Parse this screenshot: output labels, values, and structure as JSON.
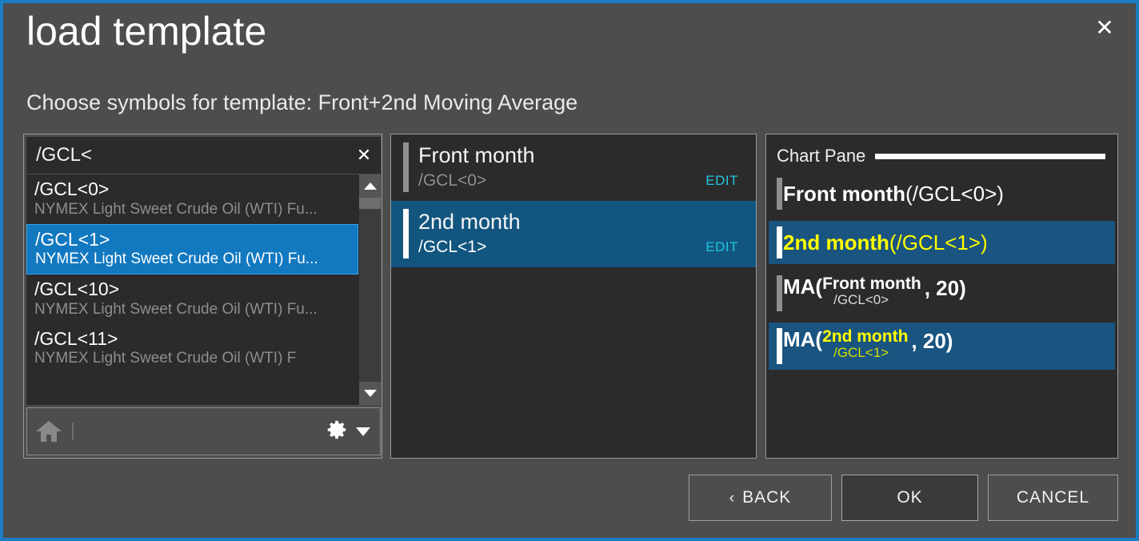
{
  "dialog": {
    "title": "load template",
    "subtitle": "Choose symbols for template: Front+2nd Moving Average",
    "close_label": "✕",
    "accent_color": "#1b7ec2",
    "background_color": "#4d4d4d"
  },
  "symbol_lookup": {
    "search": {
      "value": "/GCL<",
      "placeholder": "",
      "clear_label": "✕"
    },
    "results": [
      {
        "symbol": "/GCL<0>",
        "description": "NYMEX Light Sweet Crude Oil (WTI) Fu...",
        "selected": false
      },
      {
        "symbol": "/GCL<1>",
        "description": "NYMEX Light Sweet Crude Oil (WTI) Fu...",
        "selected": true
      },
      {
        "symbol": "/GCL<10>",
        "description": "NYMEX Light Sweet Crude Oil (WTI) Fu...",
        "selected": false
      },
      {
        "symbol": "/GCL<11>",
        "description": "NYMEX Light Sweet Crude Oil (WTI) F",
        "selected": false
      }
    ],
    "toolbar": {
      "home_icon": "home-icon",
      "settings_icon": "gear-icon",
      "settings_caret": "chevron-down-icon"
    },
    "scrollbar": {
      "up_icon": "triangle-up-icon",
      "down_icon": "triangle-down-icon"
    }
  },
  "template_symbols": {
    "rows": [
      {
        "name": "Front month",
        "symbol": "/GCL<0>",
        "edit_label": "EDIT",
        "selected": false
      },
      {
        "name": "2nd month",
        "symbol": "/GCL<1>",
        "edit_label": "EDIT",
        "selected": true
      }
    ]
  },
  "chart_pane": {
    "header": "Chart Pane",
    "plots": [
      {
        "kind": "symbol",
        "name": "Front month",
        "symbol": "(/GCL<0>)",
        "selected": false
      },
      {
        "kind": "symbol",
        "name": "2nd month",
        "symbol": "(/GCL<1>)",
        "selected": true
      },
      {
        "kind": "study",
        "prefix": "MA(",
        "name": "Front month",
        "symbol": "/GCL<0>",
        "suffix": ", 20)",
        "selected": false
      },
      {
        "kind": "study",
        "prefix": "MA(",
        "name": "2nd month",
        "symbol": "/GCL<1>",
        "suffix": ", 20)",
        "selected": true
      }
    ]
  },
  "footer": {
    "back_label": "BACK",
    "back_chevron": "‹",
    "ok_label": "OK",
    "cancel_label": "CANCEL"
  }
}
